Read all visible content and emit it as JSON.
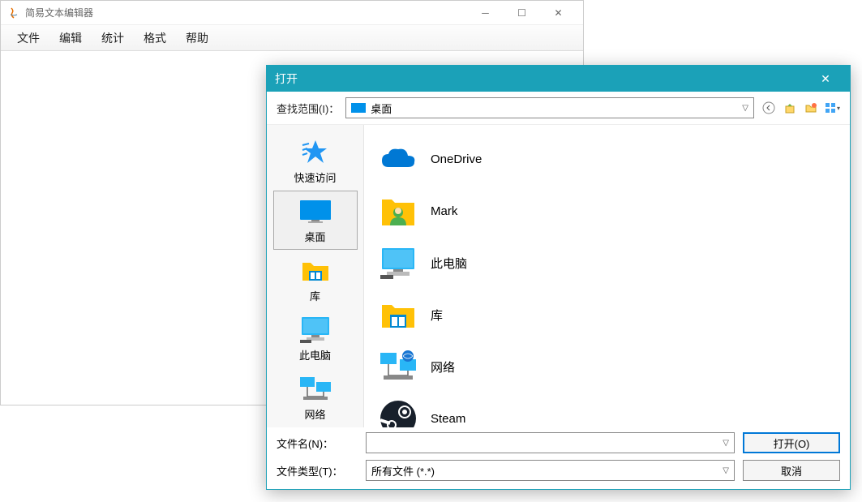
{
  "editor": {
    "title": "简易文本编辑器",
    "menu": {
      "file": "文件",
      "edit": "编辑",
      "stats": "统计",
      "format": "格式",
      "help": "帮助"
    }
  },
  "dialog": {
    "title": "打开",
    "lookup_label": "查找范围(I)：",
    "lookup_value": "桌面",
    "places": {
      "quick": "快速访问",
      "desktop": "桌面",
      "library": "库",
      "thispc": "此电脑",
      "network": "网络"
    },
    "files": {
      "onedrive": "OneDrive",
      "mark": "Mark",
      "thispc": "此电脑",
      "library": "库",
      "network": "网络",
      "steam": "Steam"
    },
    "filename_label": "文件名(N)：",
    "filename_value": "",
    "filetype_label": "文件类型(T)：",
    "filetype_value": "所有文件 (*.*)",
    "open_btn": "打开(O)",
    "cancel_btn": "取消"
  }
}
